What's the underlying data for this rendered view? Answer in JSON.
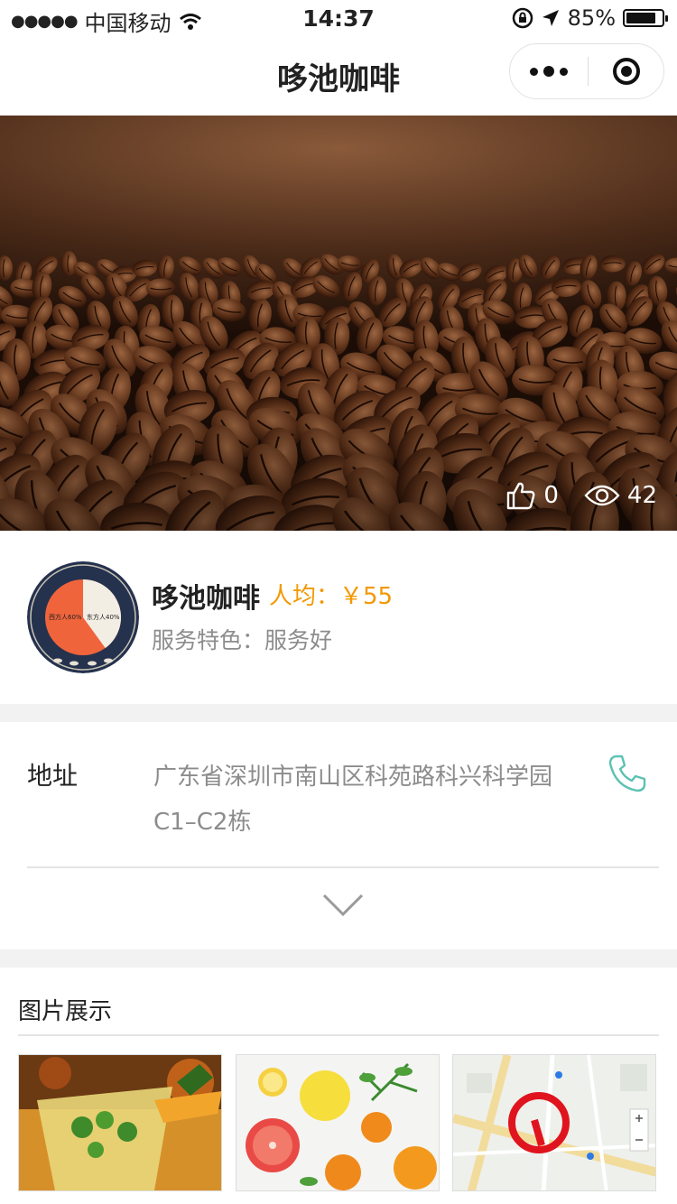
{
  "status": {
    "carrier": "中国移动",
    "time": "14:37",
    "battery_text": "85%",
    "battery_level": 0.85
  },
  "nav": {
    "title": "哆池咖啡"
  },
  "hero": {
    "likes": "0",
    "views": "42"
  },
  "shop": {
    "name": "哆池咖啡",
    "avg_price": "人均：￥55",
    "feature": "服务特色：服务好",
    "logo_labels": {
      "west": "西方人60%",
      "east": "东方人40%"
    }
  },
  "address": {
    "label": "地址",
    "text": "广东省深圳市南山区科苑路科兴科学园C1–C2栋"
  },
  "gallery": {
    "title": "图片展示"
  },
  "colors": {
    "accent_orange": "#f39800",
    "phone_teal": "#5cc2b2",
    "logo_navy": "#25324e",
    "logo_orange": "#f0643c"
  }
}
